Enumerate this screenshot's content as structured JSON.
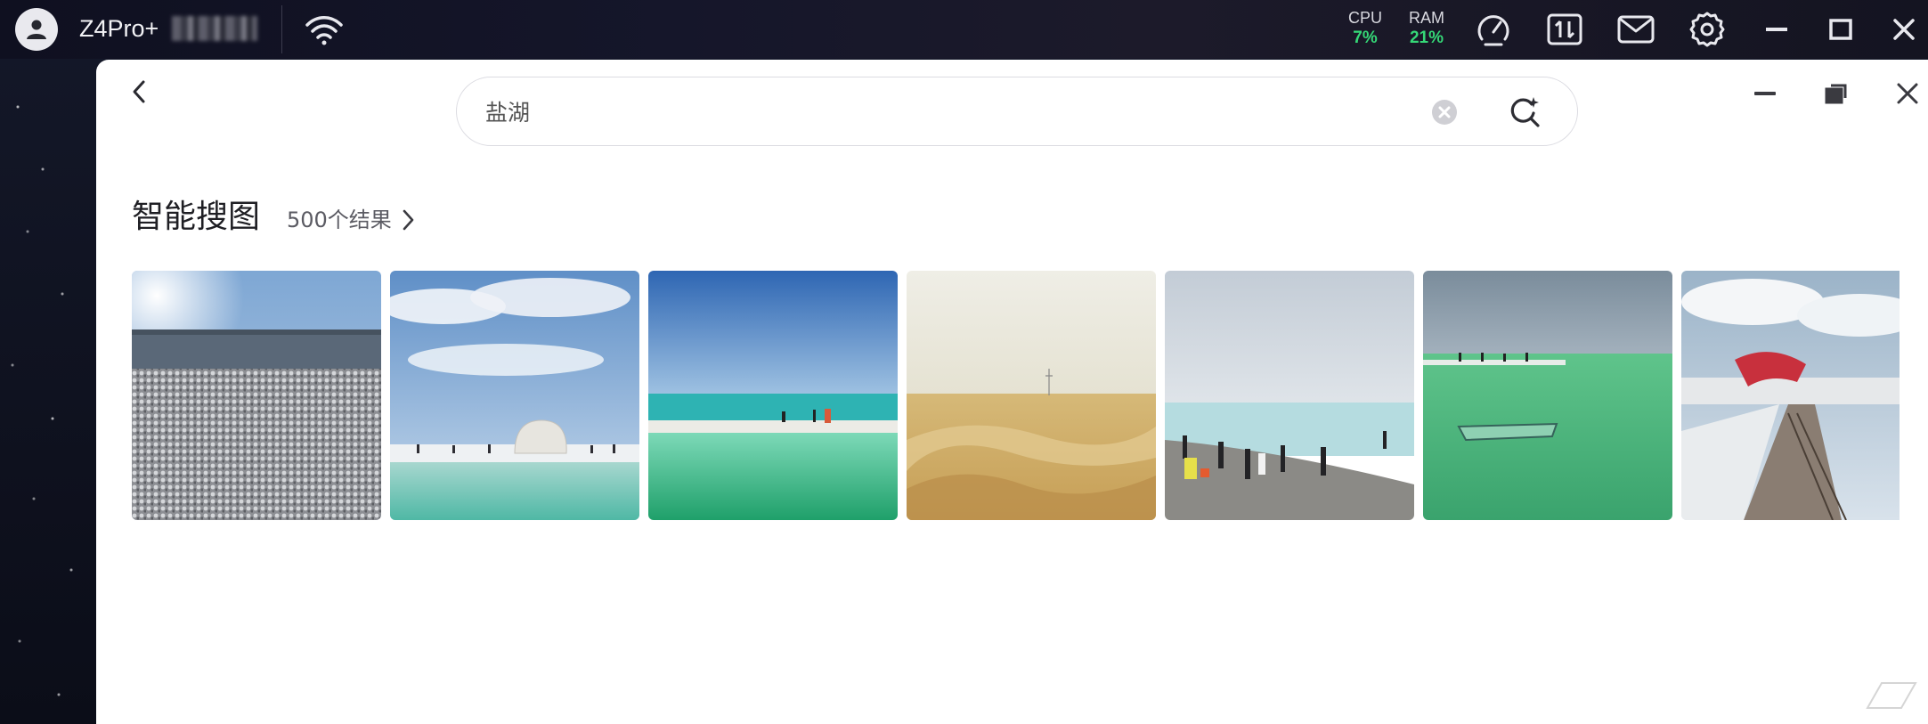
{
  "topbar": {
    "device_name": "Z4Pro+",
    "cpu_label": "CPU",
    "cpu_value": "7%",
    "ram_label": "RAM",
    "ram_value": "21%",
    "icons": [
      "user-icon",
      "wifi-icon",
      "speedometer-icon",
      "transfer-icon",
      "mail-icon",
      "gear-icon",
      "minimize-icon",
      "maximize-icon",
      "close-icon"
    ],
    "accent_color": "#35d877"
  },
  "search": {
    "query": "盐湖",
    "icons": [
      "clear-icon",
      "ai-search-icon"
    ]
  },
  "section": {
    "title": "智能搜图",
    "count": "500个结果"
  },
  "gallery": {
    "items": [
      {
        "subject": "salt-crystals-closeup"
      },
      {
        "subject": "white-dome-on-salt-lake"
      },
      {
        "subject": "turquoise-lake-shore"
      },
      {
        "subject": "sand-dunes"
      },
      {
        "subject": "crowd-at-lake-shore"
      },
      {
        "subject": "green-lake-platform"
      },
      {
        "subject": "red-sculpture-pier"
      }
    ]
  }
}
